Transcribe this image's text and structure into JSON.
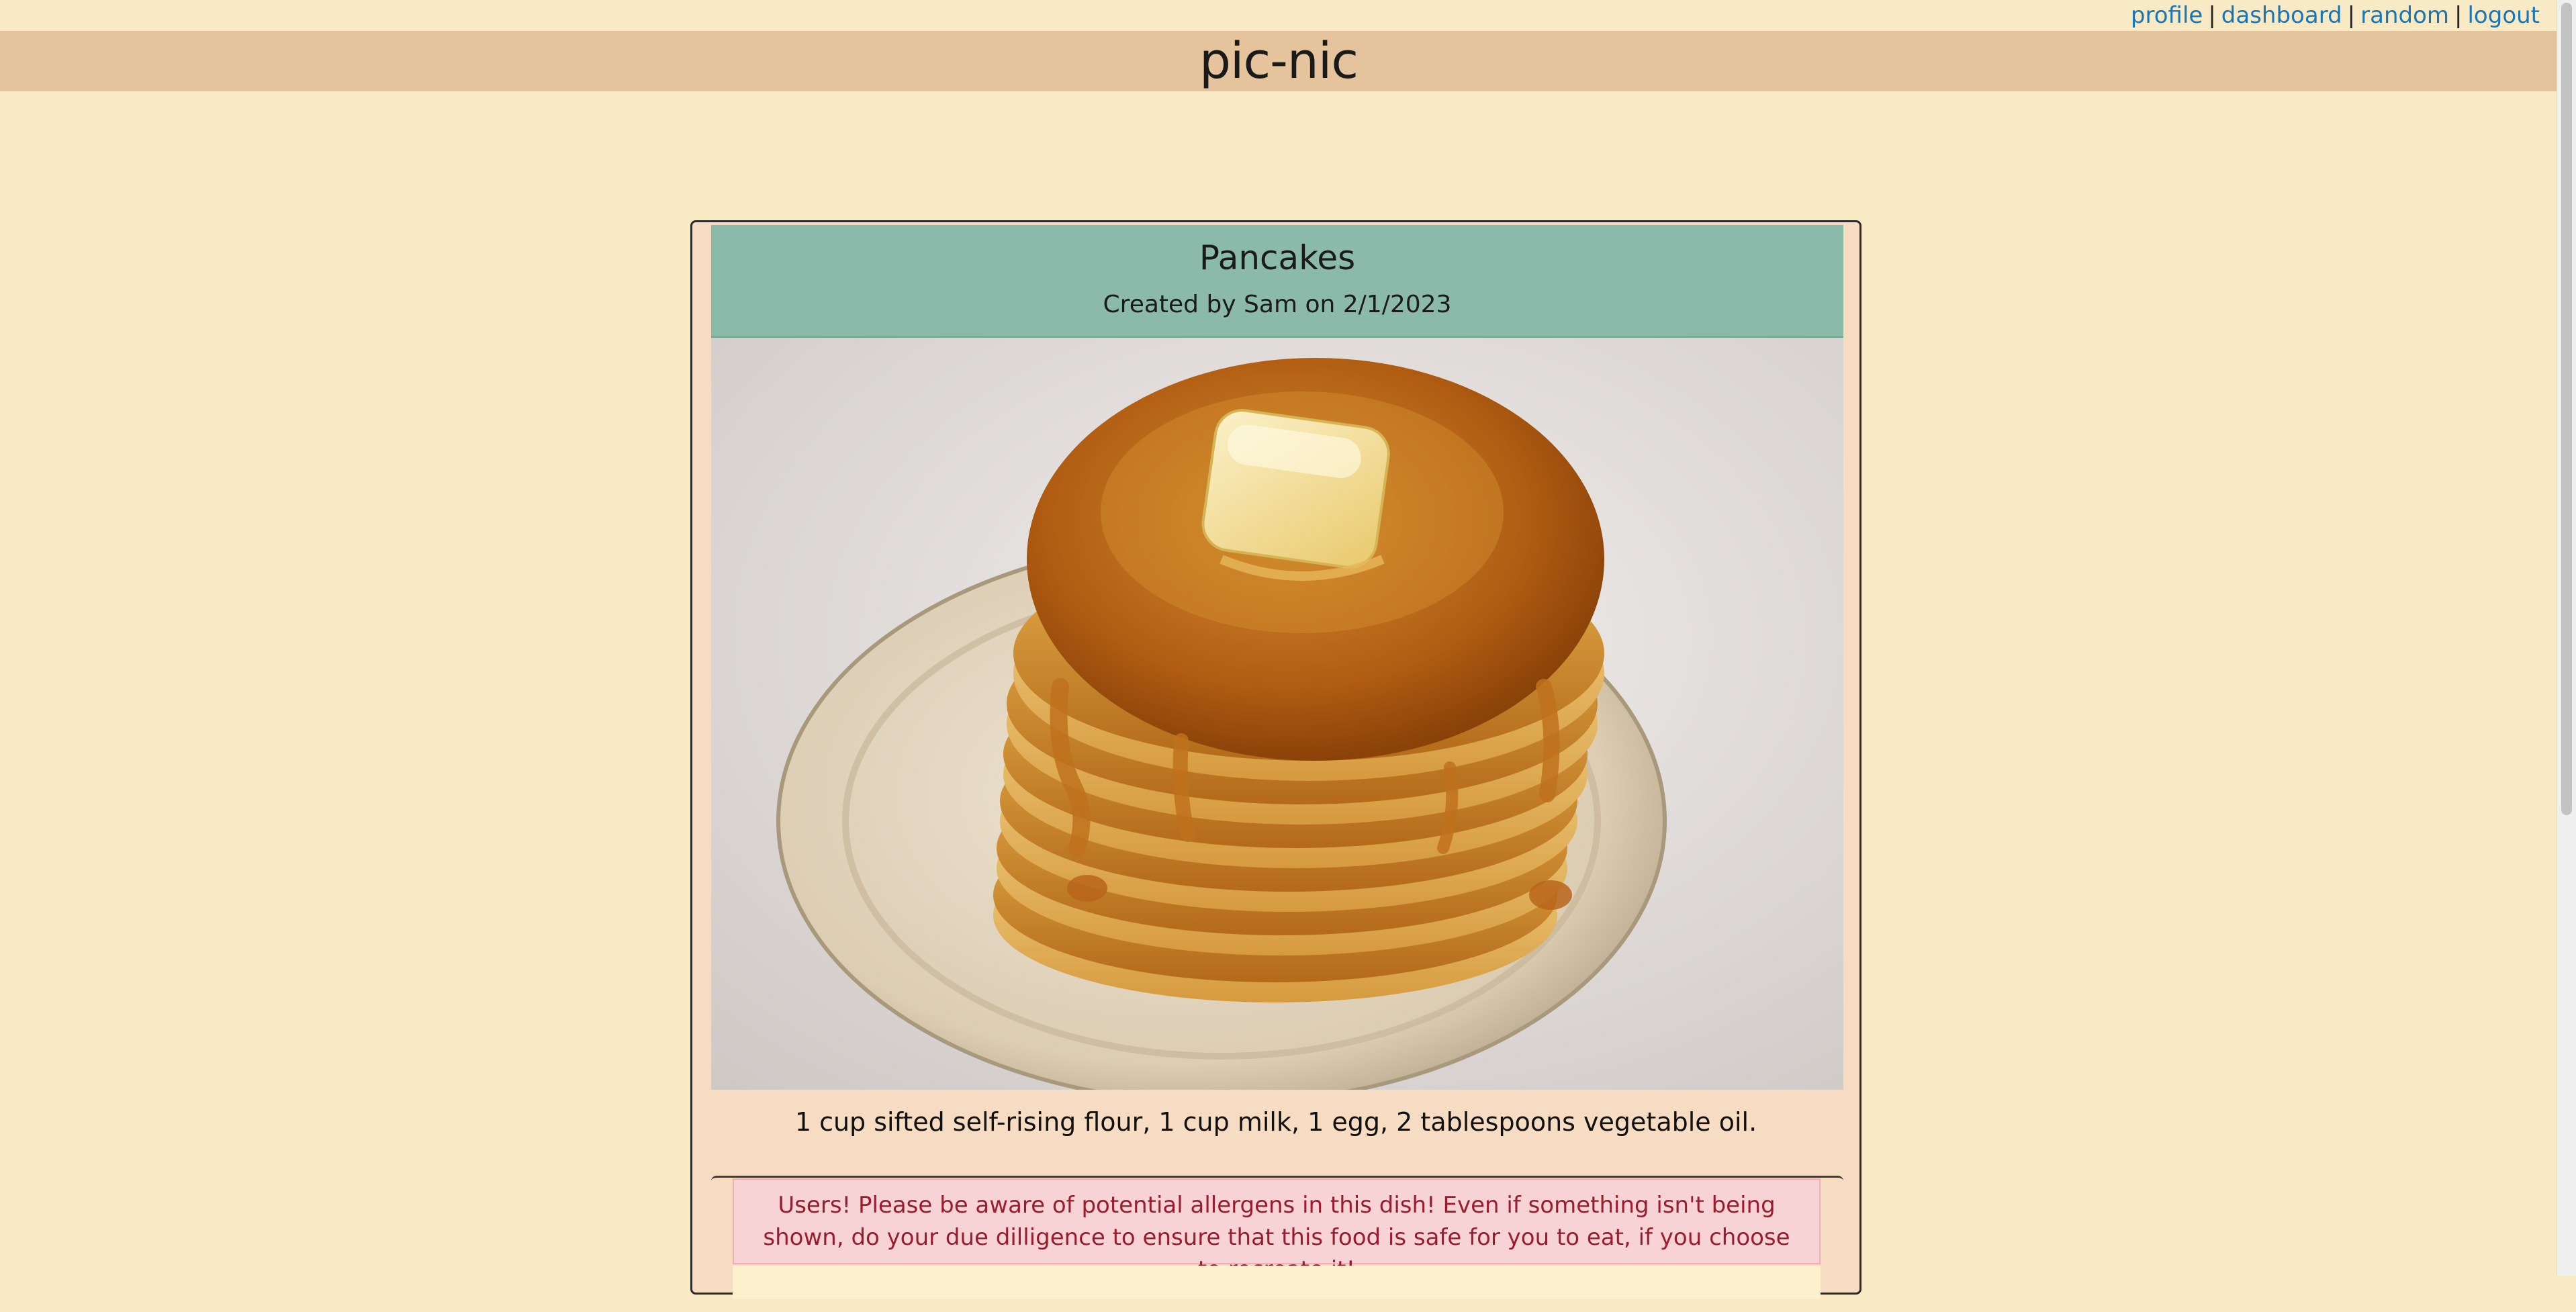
{
  "nav": {
    "profile": "profile",
    "dashboard": "dashboard",
    "random": "random",
    "logout": "logout",
    "separator": "|"
  },
  "site": {
    "title": "pic-nic"
  },
  "recipe": {
    "title": "Pancakes",
    "byline": "Created by Sam on 2/1/2023",
    "ingredients": "1 cup sifted self-rising flour, 1 cup milk, 1 egg, 2 tablespoons vegetable oil."
  },
  "alert": {
    "message": "Users! Please be aware of potential allergens in this dish! Even if something isn't being shown, do your due dilligence to ensure that this food is safe for you to eat, if you choose to recreate it!"
  },
  "colors": {
    "page_background": "#f7eac4",
    "header_band": "#e5c49d",
    "card_background": "#f5dcc3",
    "card_header": "#8cbaaa",
    "link": "#1876b8",
    "alert_background": "#f8d3d5",
    "alert_text": "#9a1d2e"
  },
  "icons": {
    "photo": "pancake-stack-photo"
  }
}
